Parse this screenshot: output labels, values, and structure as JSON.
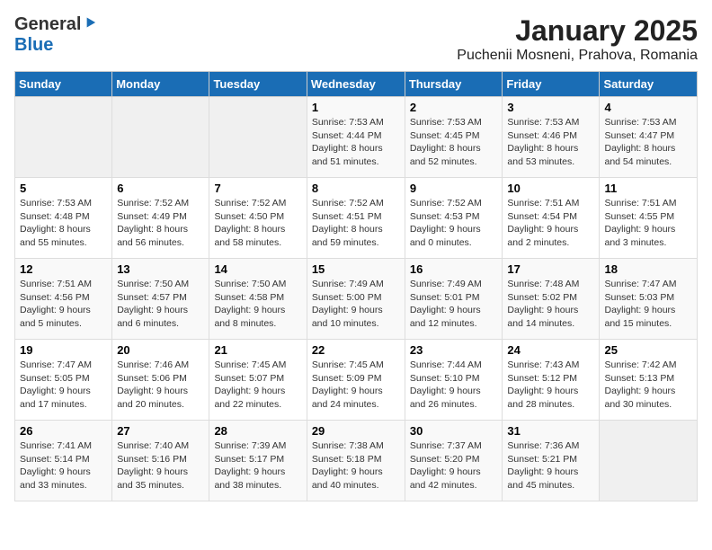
{
  "header": {
    "logo_general": "General",
    "logo_blue": "Blue",
    "title": "January 2025",
    "subtitle": "Puchenii Mosneni, Prahova, Romania"
  },
  "calendar": {
    "days_of_week": [
      "Sunday",
      "Monday",
      "Tuesday",
      "Wednesday",
      "Thursday",
      "Friday",
      "Saturday"
    ],
    "weeks": [
      [
        {
          "day": "",
          "info": ""
        },
        {
          "day": "",
          "info": ""
        },
        {
          "day": "",
          "info": ""
        },
        {
          "day": "1",
          "info": "Sunrise: 7:53 AM\nSunset: 4:44 PM\nDaylight: 8 hours and 51 minutes."
        },
        {
          "day": "2",
          "info": "Sunrise: 7:53 AM\nSunset: 4:45 PM\nDaylight: 8 hours and 52 minutes."
        },
        {
          "day": "3",
          "info": "Sunrise: 7:53 AM\nSunset: 4:46 PM\nDaylight: 8 hours and 53 minutes."
        },
        {
          "day": "4",
          "info": "Sunrise: 7:53 AM\nSunset: 4:47 PM\nDaylight: 8 hours and 54 minutes."
        }
      ],
      [
        {
          "day": "5",
          "info": "Sunrise: 7:53 AM\nSunset: 4:48 PM\nDaylight: 8 hours and 55 minutes."
        },
        {
          "day": "6",
          "info": "Sunrise: 7:52 AM\nSunset: 4:49 PM\nDaylight: 8 hours and 56 minutes."
        },
        {
          "day": "7",
          "info": "Sunrise: 7:52 AM\nSunset: 4:50 PM\nDaylight: 8 hours and 58 minutes."
        },
        {
          "day": "8",
          "info": "Sunrise: 7:52 AM\nSunset: 4:51 PM\nDaylight: 8 hours and 59 minutes."
        },
        {
          "day": "9",
          "info": "Sunrise: 7:52 AM\nSunset: 4:53 PM\nDaylight: 9 hours and 0 minutes."
        },
        {
          "day": "10",
          "info": "Sunrise: 7:51 AM\nSunset: 4:54 PM\nDaylight: 9 hours and 2 minutes."
        },
        {
          "day": "11",
          "info": "Sunrise: 7:51 AM\nSunset: 4:55 PM\nDaylight: 9 hours and 3 minutes."
        }
      ],
      [
        {
          "day": "12",
          "info": "Sunrise: 7:51 AM\nSunset: 4:56 PM\nDaylight: 9 hours and 5 minutes."
        },
        {
          "day": "13",
          "info": "Sunrise: 7:50 AM\nSunset: 4:57 PM\nDaylight: 9 hours and 6 minutes."
        },
        {
          "day": "14",
          "info": "Sunrise: 7:50 AM\nSunset: 4:58 PM\nDaylight: 9 hours and 8 minutes."
        },
        {
          "day": "15",
          "info": "Sunrise: 7:49 AM\nSunset: 5:00 PM\nDaylight: 9 hours and 10 minutes."
        },
        {
          "day": "16",
          "info": "Sunrise: 7:49 AM\nSunset: 5:01 PM\nDaylight: 9 hours and 12 minutes."
        },
        {
          "day": "17",
          "info": "Sunrise: 7:48 AM\nSunset: 5:02 PM\nDaylight: 9 hours and 14 minutes."
        },
        {
          "day": "18",
          "info": "Sunrise: 7:47 AM\nSunset: 5:03 PM\nDaylight: 9 hours and 15 minutes."
        }
      ],
      [
        {
          "day": "19",
          "info": "Sunrise: 7:47 AM\nSunset: 5:05 PM\nDaylight: 9 hours and 17 minutes."
        },
        {
          "day": "20",
          "info": "Sunrise: 7:46 AM\nSunset: 5:06 PM\nDaylight: 9 hours and 20 minutes."
        },
        {
          "day": "21",
          "info": "Sunrise: 7:45 AM\nSunset: 5:07 PM\nDaylight: 9 hours and 22 minutes."
        },
        {
          "day": "22",
          "info": "Sunrise: 7:45 AM\nSunset: 5:09 PM\nDaylight: 9 hours and 24 minutes."
        },
        {
          "day": "23",
          "info": "Sunrise: 7:44 AM\nSunset: 5:10 PM\nDaylight: 9 hours and 26 minutes."
        },
        {
          "day": "24",
          "info": "Sunrise: 7:43 AM\nSunset: 5:12 PM\nDaylight: 9 hours and 28 minutes."
        },
        {
          "day": "25",
          "info": "Sunrise: 7:42 AM\nSunset: 5:13 PM\nDaylight: 9 hours and 30 minutes."
        }
      ],
      [
        {
          "day": "26",
          "info": "Sunrise: 7:41 AM\nSunset: 5:14 PM\nDaylight: 9 hours and 33 minutes."
        },
        {
          "day": "27",
          "info": "Sunrise: 7:40 AM\nSunset: 5:16 PM\nDaylight: 9 hours and 35 minutes."
        },
        {
          "day": "28",
          "info": "Sunrise: 7:39 AM\nSunset: 5:17 PM\nDaylight: 9 hours and 38 minutes."
        },
        {
          "day": "29",
          "info": "Sunrise: 7:38 AM\nSunset: 5:18 PM\nDaylight: 9 hours and 40 minutes."
        },
        {
          "day": "30",
          "info": "Sunrise: 7:37 AM\nSunset: 5:20 PM\nDaylight: 9 hours and 42 minutes."
        },
        {
          "day": "31",
          "info": "Sunrise: 7:36 AM\nSunset: 5:21 PM\nDaylight: 9 hours and 45 minutes."
        },
        {
          "day": "",
          "info": ""
        }
      ]
    ]
  }
}
